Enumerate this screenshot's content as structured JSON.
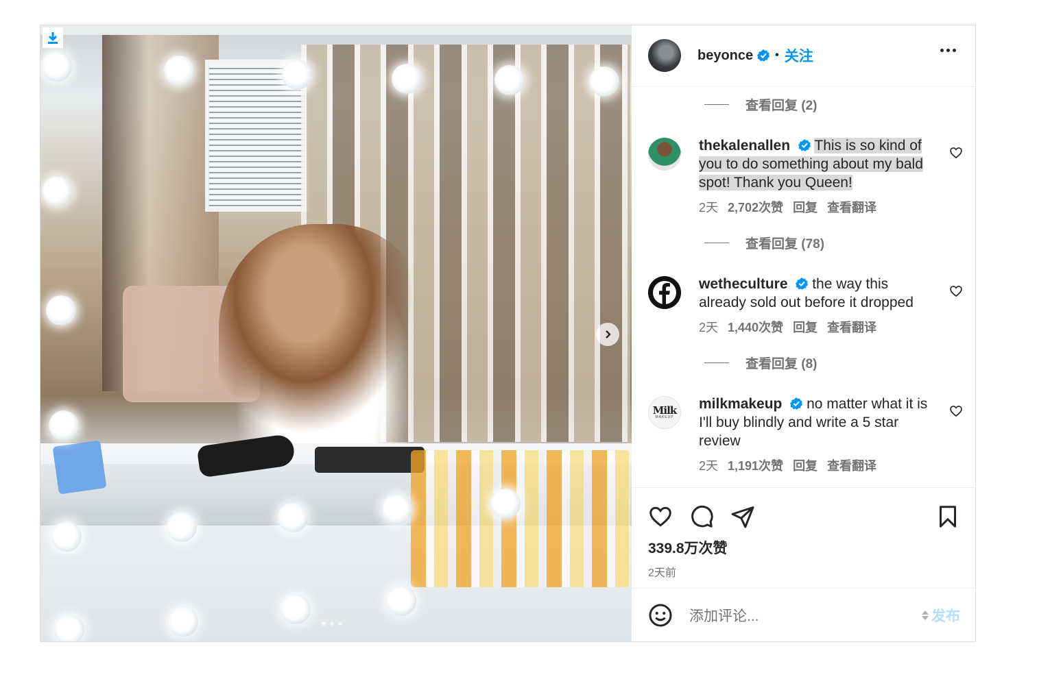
{
  "post": {
    "username": "beyonce",
    "follow_label": "关注",
    "separator": "•",
    "more_icon": "more-horizontal-icon",
    "media": {
      "download_icon": "download-icon",
      "next_icon": "chevron-right-icon",
      "slide_count": 3,
      "active_slide": 1
    }
  },
  "comments": {
    "items": [
      {
        "replies_label": "查看回复 (2)"
      },
      {
        "username": "thekalenallen",
        "verified": true,
        "text": "This is so kind of you to do something about my bald spot! Thank you Queen!",
        "highlighted": true,
        "time": "2天",
        "likes": "2,702次赞",
        "reply_label": "回复",
        "translate_label": "查看翻译",
        "replies_label": "查看回复 (78)"
      },
      {
        "username": "wetheculture",
        "verified": true,
        "text": "the way this already sold out before it dropped",
        "time": "2天",
        "likes": "1,440次赞",
        "reply_label": "回复",
        "translate_label": "查看翻译",
        "replies_label": "查看回复 (8)"
      },
      {
        "username": "milkmakeup",
        "verified": true,
        "avatar_text": "Milk",
        "avatar_subtext": "MAKEUP",
        "text": "no matter what it is I'll buy blindly and write a 5 star review",
        "time": "2天",
        "likes": "1,191次赞",
        "reply_label": "回复",
        "translate_label": "查看翻译"
      }
    ]
  },
  "actions": {
    "like_icon": "heart-icon",
    "comment_icon": "comment-icon",
    "share_icon": "send-icon",
    "save_icon": "bookmark-icon",
    "likes_count": "339.8万次赞",
    "posted_time": "2天前"
  },
  "composer": {
    "emoji_icon": "emoji-icon",
    "placeholder": "添加评论...",
    "post_label": "发布"
  },
  "colors": {
    "accent": "#0095f6",
    "accent_disabled": "#b2dffc",
    "text": "#262626",
    "muted": "#737373",
    "highlight": "#d9d9d9"
  }
}
